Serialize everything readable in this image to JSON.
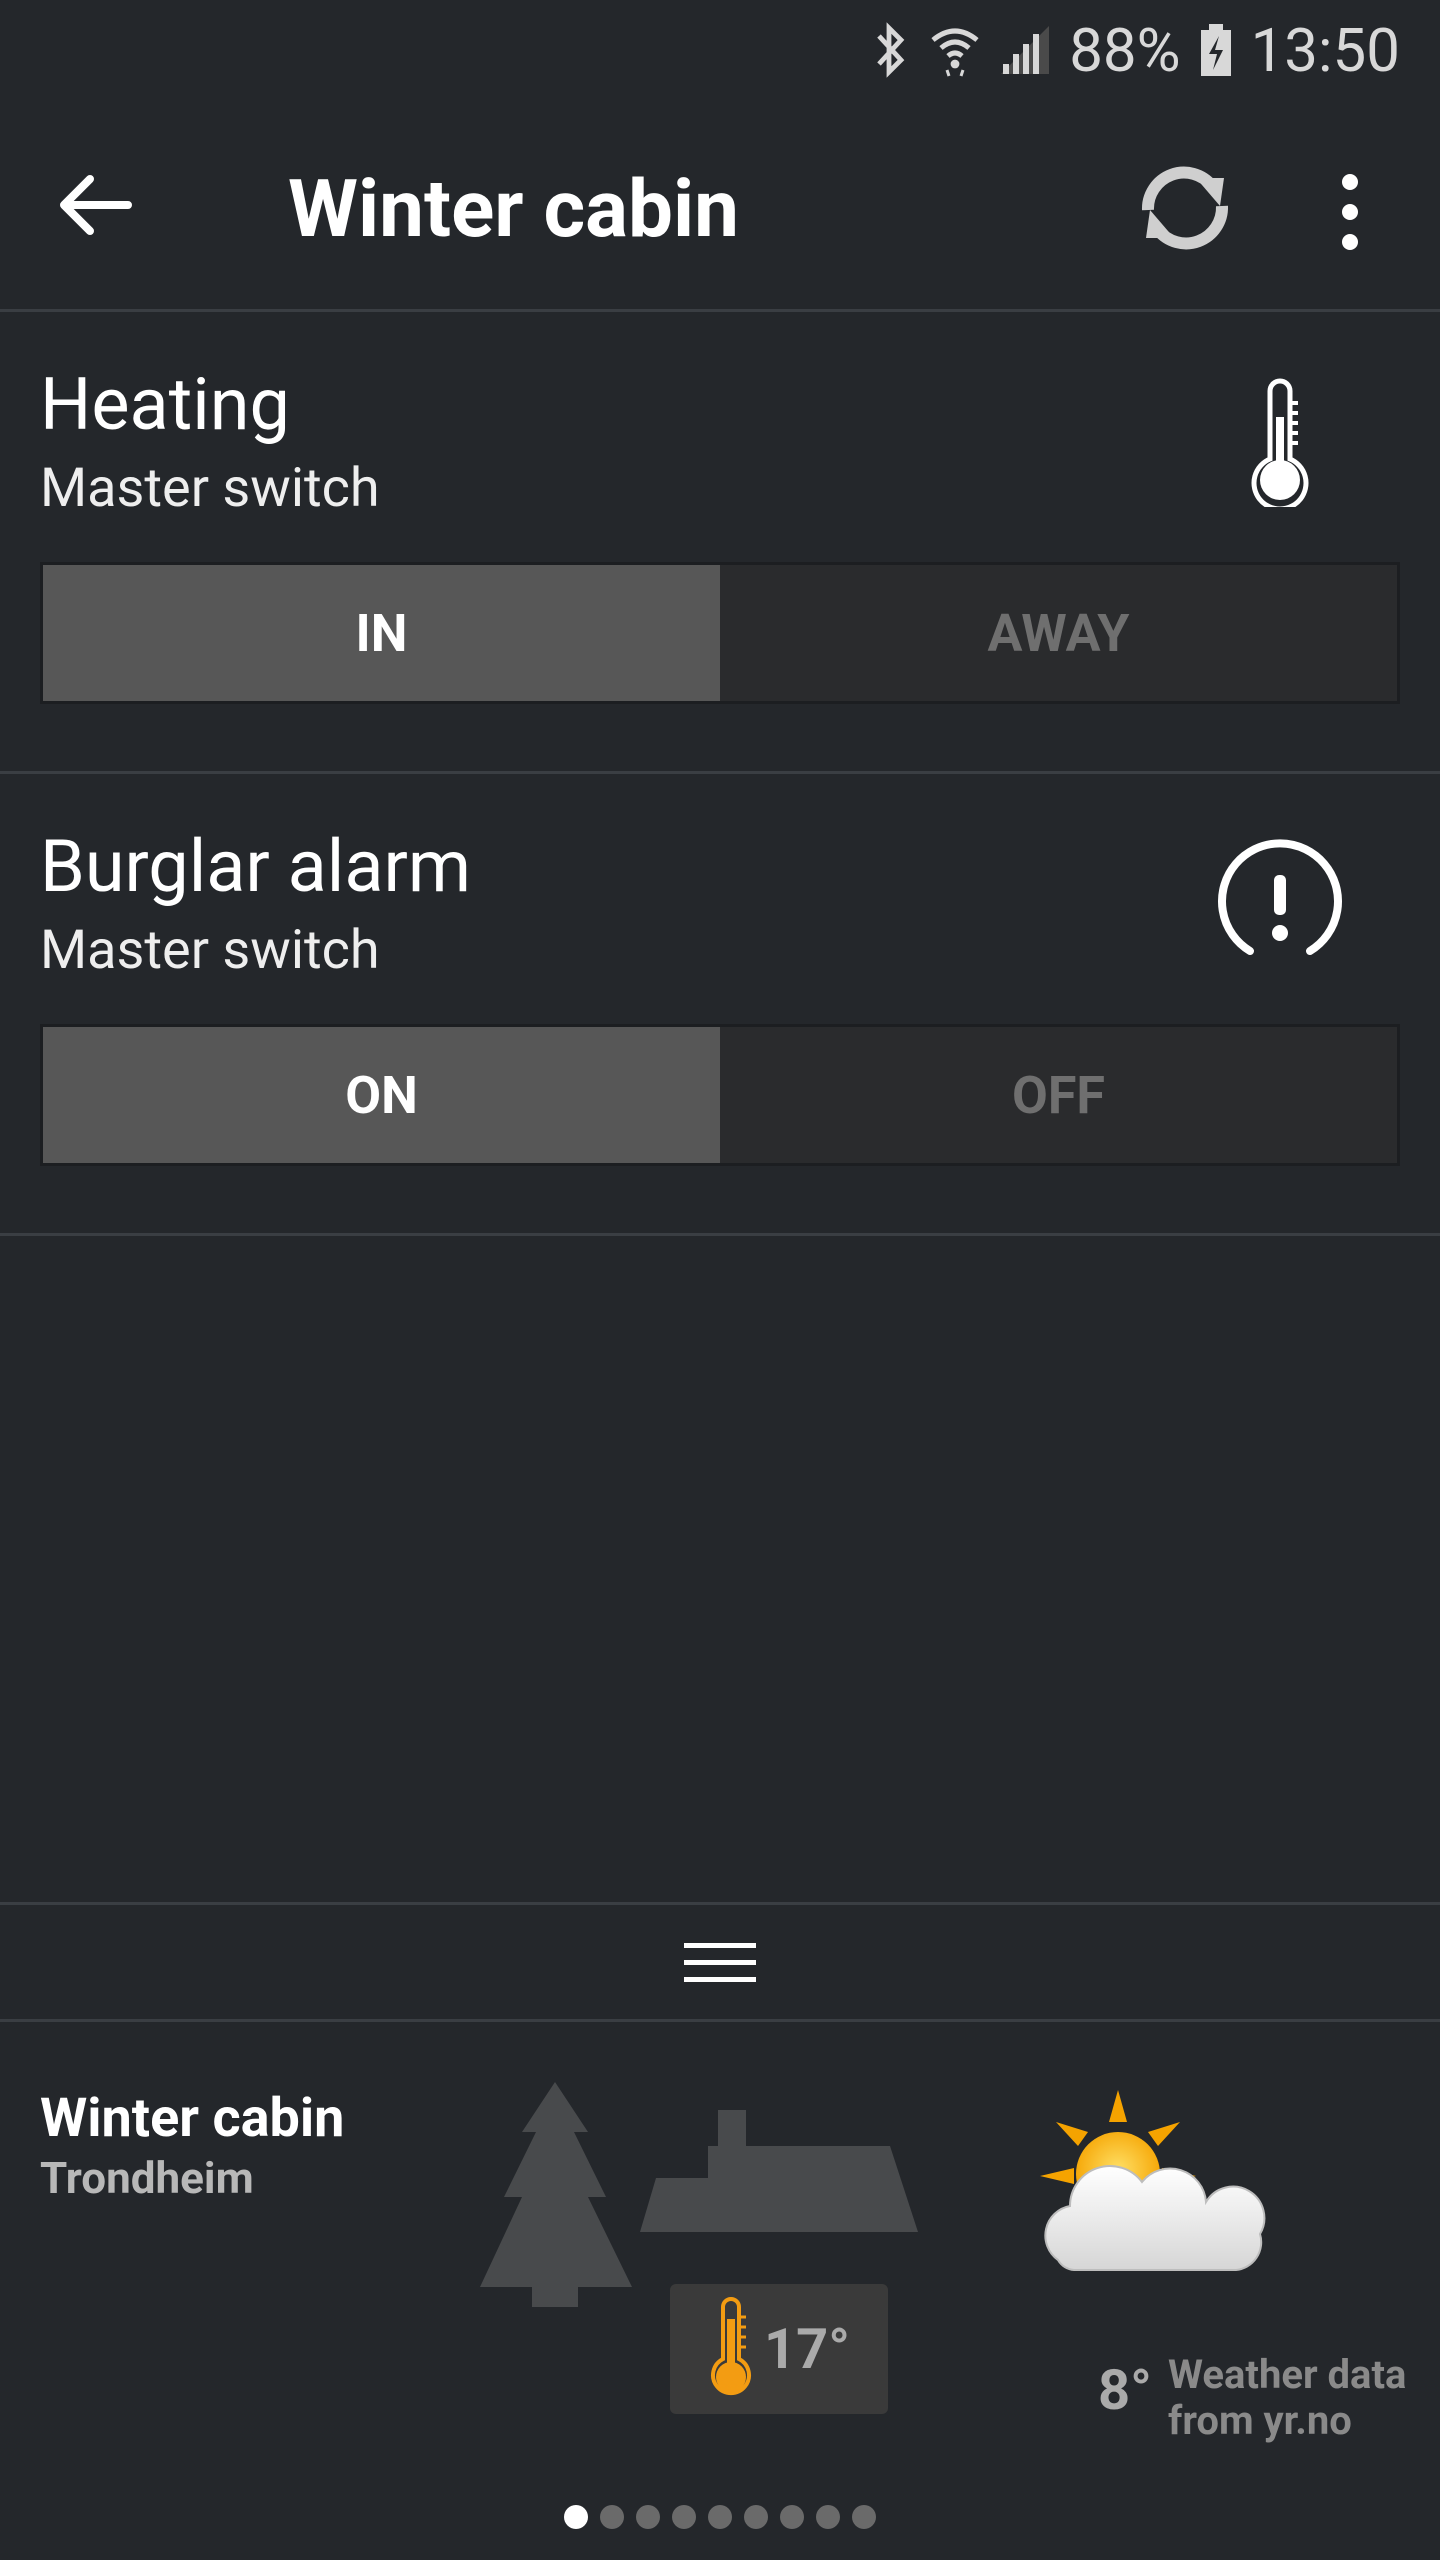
{
  "status": {
    "battery": "88%",
    "time": "13:50"
  },
  "appbar": {
    "title": "Winter cabin"
  },
  "heating": {
    "title": "Heating",
    "subtitle": "Master switch",
    "options": [
      "IN",
      "AWAY"
    ],
    "selected": "IN"
  },
  "alarm": {
    "title": "Burglar alarm",
    "subtitle": "Master switch",
    "options": [
      "ON",
      "OFF"
    ],
    "selected": "ON"
  },
  "location": {
    "name": "Winter cabin",
    "city": "Trondheim",
    "indoor_temp": "17°"
  },
  "weather": {
    "temp": "8°",
    "credit_line1": "Weather data",
    "credit_line2": "from yr.no"
  },
  "pager": {
    "count": 9,
    "active": 0
  },
  "colors": {
    "background": "#24272b",
    "active_segment": "#575757",
    "accent_orange": "#f39c12"
  }
}
